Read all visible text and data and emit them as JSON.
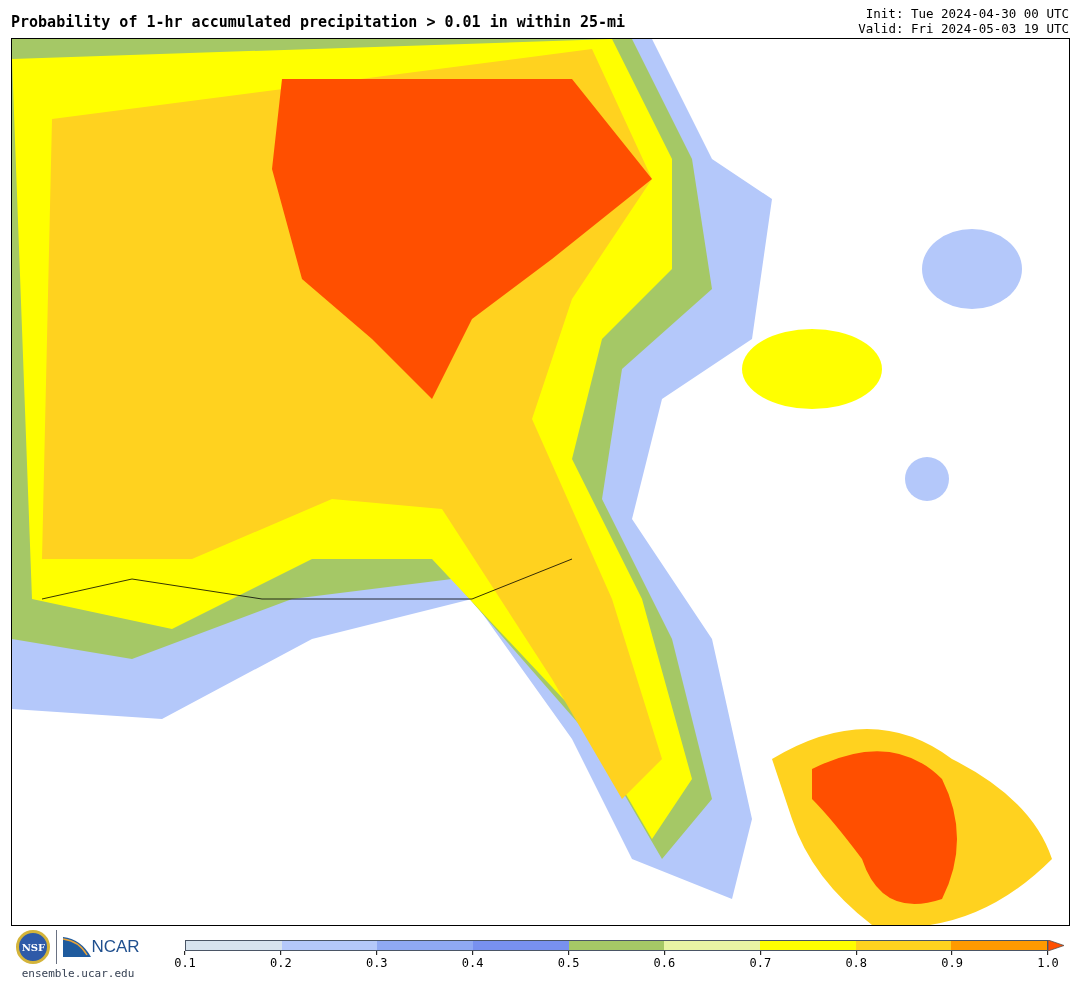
{
  "title": "Probability of 1-hr accumulated precipitation > 0.01 in within 25-mi",
  "init": "Init: Tue 2024-04-30 00 UTC",
  "valid": "Valid: Fri 2024-05-03 19 UTC",
  "logos": {
    "nsf": "NSF",
    "ncar": "NCAR",
    "website": "ensemble.ucar.edu"
  },
  "colorbar": {
    "bins": [
      {
        "kind": "bin",
        "color": "#d7e3ee"
      },
      {
        "kind": "bin",
        "color": "#b4c8fa"
      },
      {
        "kind": "bin",
        "color": "#8fa9f4"
      },
      {
        "kind": "bin",
        "color": "#7891f0"
      },
      {
        "kind": "bin",
        "color": "#a5c866"
      },
      {
        "kind": "bin",
        "color": "#e8f4a4"
      },
      {
        "kind": "bin",
        "color": "#ffff00"
      },
      {
        "kind": "bin",
        "color": "#ffd21f"
      },
      {
        "kind": "bin",
        "color": "#ff9a00"
      },
      {
        "kind": "extension",
        "color": "#ff4f00"
      }
    ],
    "ticks": [
      "0.1",
      "0.2",
      "0.3",
      "0.4",
      "0.5",
      "0.6",
      "0.7",
      "0.8",
      "0.9",
      "1.0"
    ]
  }
}
